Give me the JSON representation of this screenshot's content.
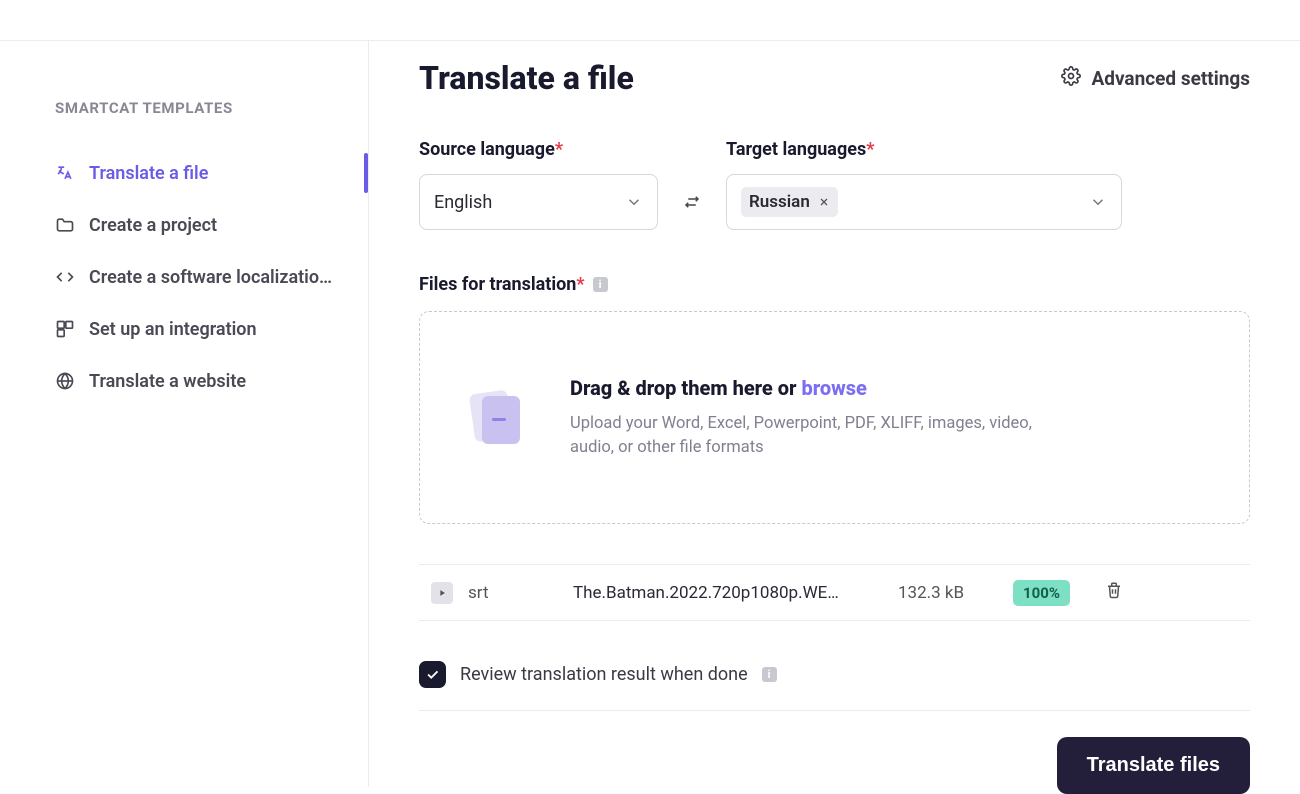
{
  "sidebar": {
    "heading": "SMARTCAT TEMPLATES",
    "items": [
      {
        "label": "Translate a file",
        "active": true
      },
      {
        "label": "Create a project"
      },
      {
        "label": "Create a software localizatio…"
      },
      {
        "label": "Set up an integration"
      },
      {
        "label": "Translate a website"
      }
    ]
  },
  "header": {
    "title": "Translate a file",
    "advanced": "Advanced settings"
  },
  "lang": {
    "source_label": "Source language",
    "source_value": "English",
    "target_label": "Target languages",
    "target_chip": "Russian"
  },
  "files": {
    "label": "Files for translation",
    "drop_head_a": "Drag & drop them here or ",
    "drop_head_b": "browse",
    "drop_sub": "Upload your Word, Excel, Powerpoint, PDF, XLIFF, images, video, audio, or other file formats"
  },
  "file_row": {
    "ext": "srt",
    "name": "The.Batman.2022.720p1080p.WE…",
    "size": "132.3 kB",
    "progress": "100%"
  },
  "review": {
    "label": "Review translation result when done",
    "checked": true
  },
  "cta": "Translate files"
}
